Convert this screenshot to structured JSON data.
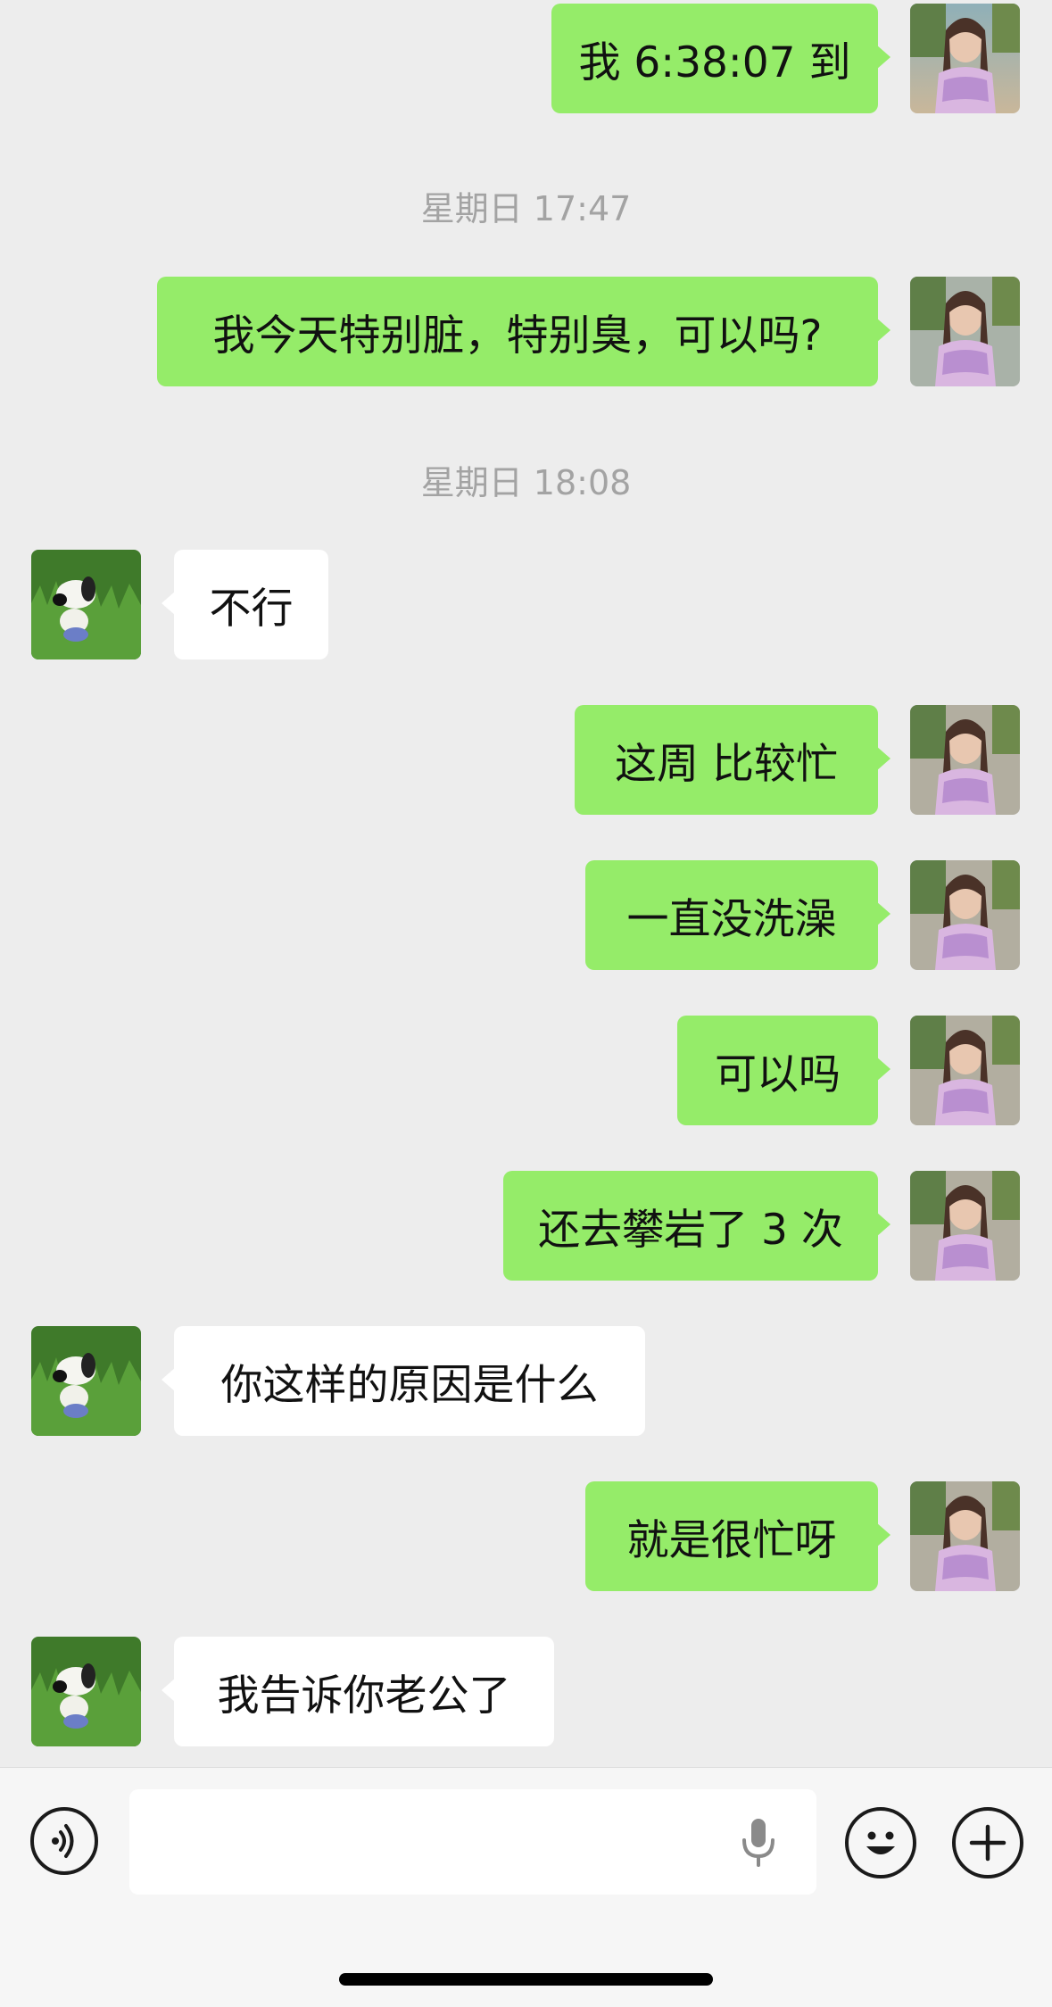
{
  "messages": [
    {
      "side": "me",
      "text": "我 6:38:07 到"
    },
    {
      "time": "星期日 17:47"
    },
    {
      "side": "me",
      "text": "我今天特别脏，特别臭，可以吗?"
    },
    {
      "time": "星期日 18:08"
    },
    {
      "side": "them",
      "text": "不行"
    },
    {
      "side": "me",
      "text": "这周 比较忙"
    },
    {
      "side": "me",
      "text": "一直没洗澡"
    },
    {
      "side": "me",
      "text": "可以吗"
    },
    {
      "side": "me",
      "text": "还去攀岩了 3 次"
    },
    {
      "side": "them",
      "text": "你这样的原因是什么"
    },
    {
      "side": "me",
      "text": "就是很忙呀"
    },
    {
      "side": "them",
      "text": "我告诉你老公了"
    }
  ],
  "input": {
    "value": "",
    "placeholder": ""
  },
  "colors": {
    "sent_bubble": "#95ec69",
    "received_bubble": "#ffffff",
    "background": "#ededed"
  },
  "icons": {
    "voice": "voice-toggle-icon",
    "mic": "microphone-icon",
    "emoji": "emoji-icon",
    "plus": "plus-icon"
  }
}
